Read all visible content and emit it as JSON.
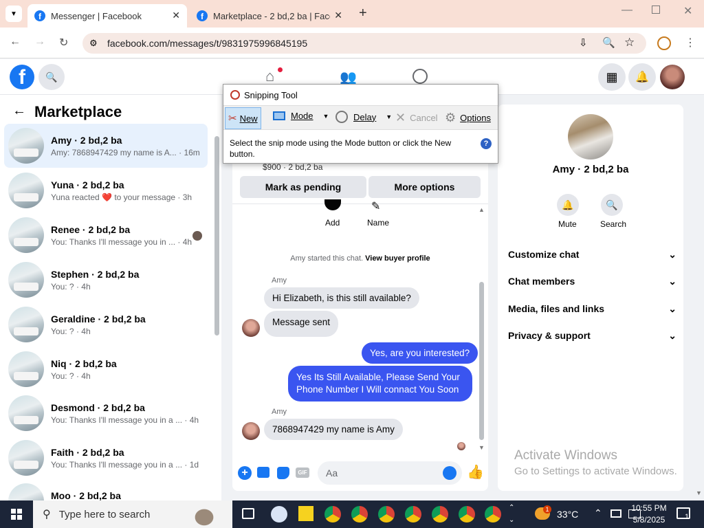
{
  "browser": {
    "tabs": [
      {
        "title": "Messenger | Facebook"
      },
      {
        "title": "Marketplace - 2 bd,2 ba | Faceb"
      }
    ],
    "url": "facebook.com/messages/t/9831975996845195"
  },
  "sidebar": {
    "title": "Marketplace",
    "items": [
      {
        "name": "Amy · 2 bd,2 ba",
        "preview": "Amy: 7868947429 my name is A...",
        "time": "· 16m"
      },
      {
        "name": "Yuna · 2 bd,2 ba",
        "preview": "Yuna reacted ❤️ to your message",
        "time": "· 3h"
      },
      {
        "name": "Renee · 2 bd,2 ba",
        "preview": "You: Thanks I'll message you in ...",
        "time": "· 4h"
      },
      {
        "name": "Stephen · 2 bd,2 ba",
        "preview": "You: ?",
        "time": "· 4h"
      },
      {
        "name": "Geraldine · 2 bd,2 ba",
        "preview": "You: ?",
        "time": "· 4h"
      },
      {
        "name": "Niq · 2 bd,2 ba",
        "preview": "You: ?",
        "time": "· 4h"
      },
      {
        "name": "Desmond · 2 bd,2 ba",
        "preview": "You: Thanks I'll message you in a ...",
        "time": "· 4h"
      },
      {
        "name": "Faith · 2 bd,2 ba",
        "preview": "You: Thanks I'll message you in a ...",
        "time": "· 1d"
      },
      {
        "name": "Moo · 2 bd,2 ba",
        "preview": "",
        "time": ""
      }
    ]
  },
  "chat": {
    "price": "$900 · 2 bd,2 ba",
    "mark_pending": "Mark as pending",
    "more_options": "More options",
    "add": "Add",
    "name": "Name",
    "started": "Amy started this chat.",
    "view_profile": "View buyer profile",
    "sender": "Amy",
    "messages": {
      "m1": "Hi Elizabeth, is this still available?",
      "m2": "Message sent",
      "m3": "Yes, are you interested?",
      "m4": "Yes Its Still Available, Please Send Your Phone Number I Will connact You Soon",
      "m5": "7868947429 my name is Amy"
    },
    "input_placeholder": "Aa"
  },
  "details": {
    "title": "Amy · 2 bd,2 ba",
    "mute": "Mute",
    "search": "Search",
    "sections": [
      "Customize chat",
      "Chat members",
      "Media, files and links",
      "Privacy & support"
    ]
  },
  "snipping": {
    "title": "Snipping Tool",
    "new": "New",
    "mode": "Mode",
    "delay": "Delay",
    "cancel": "Cancel",
    "options": "Options",
    "hint": "Select the snip mode using the Mode button or click the New button."
  },
  "watermark": {
    "title": "Activate Windows",
    "sub": "Go to Settings to activate Windows."
  },
  "taskbar": {
    "search_placeholder": "Type here to search",
    "temp": "33°C",
    "time": "10:55 PM",
    "date": "5/8/2025",
    "weather_badge": "1",
    "notif_count": "1"
  },
  "colors": {
    "fb_blue": "#1877f2",
    "bubble_out": "#3a55f0",
    "selected_row": "#e7f1fd"
  }
}
